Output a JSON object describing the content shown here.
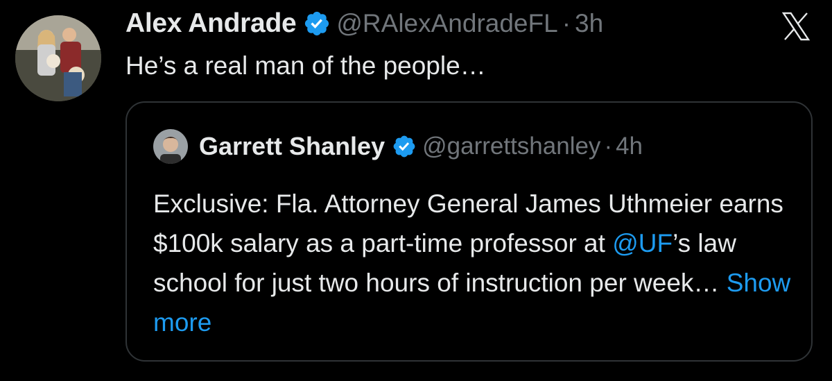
{
  "tweet": {
    "author_name": "Alex Andrade",
    "author_handle": "@RAlexAndradeFL",
    "separator": "·",
    "time": "3h",
    "text": "He’s a real man of the people…",
    "verified": true
  },
  "quoted": {
    "author_name": "Garrett Shanley",
    "author_handle": "@garrettshanley",
    "separator": "·",
    "time": "4h",
    "verified": true,
    "text_part1": "Exclusive: Fla. Attorney General James Uthmeier earns $100k salary as a part-time professor at ",
    "mention": "@UF",
    "text_part2": "’s law school for just two hours of instruction per week… ",
    "show_more": "Show more"
  },
  "colors": {
    "background": "#000000",
    "primary_text": "#e7e9ea",
    "secondary_text": "#71767b",
    "link": "#1d9bf0",
    "border": "#2f3336"
  },
  "icons": {
    "verified": "verified-badge-icon",
    "brand": "x-logo-icon"
  }
}
